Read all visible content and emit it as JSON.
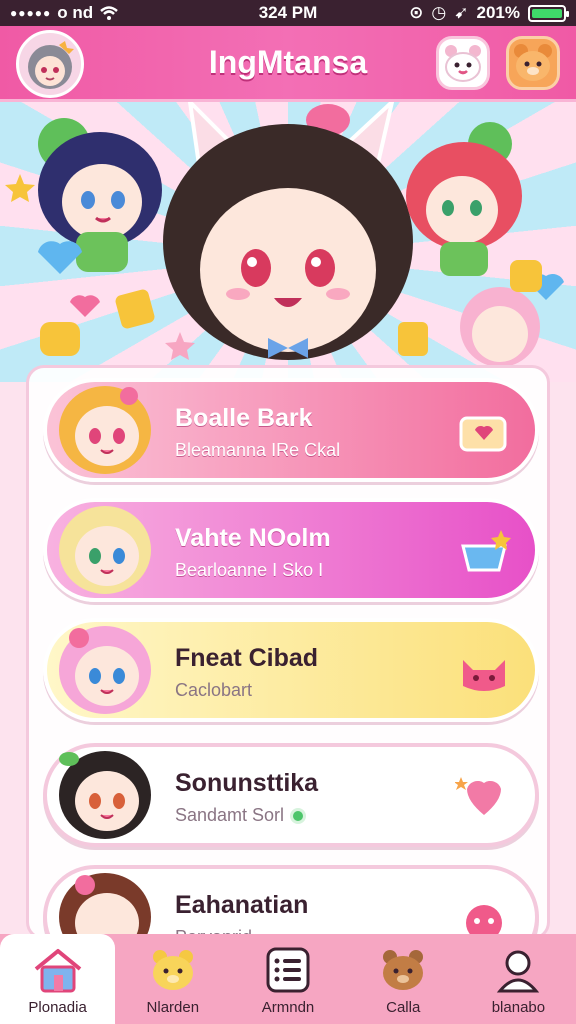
{
  "status_bar": {
    "carrier": "o nd",
    "time": "324 PM",
    "battery": "201%"
  },
  "header": {
    "title": "IngMtansa"
  },
  "cards": [
    {
      "title": "Boalle Bark",
      "subtitle": "Bleamanna IRe Ckal",
      "icon": "heart-box-icon"
    },
    {
      "title": "Vahte NOolm",
      "subtitle": "Bearloanne I Sko I",
      "icon": "basket-icon"
    },
    {
      "title": "Fneat Cibad",
      "subtitle": "Caclobart",
      "icon": "cat-face-icon"
    },
    {
      "title": "Sonunsttika",
      "subtitle": "Sandamt Sorl",
      "icon": "heart-icon"
    },
    {
      "title": "Eahanatian",
      "subtitle": "Porvanrid",
      "icon": "monster-icon"
    }
  ],
  "bottom_nav": [
    {
      "label": "Plonadia",
      "icon": "house-icon",
      "active": true
    },
    {
      "label": "Nlarden",
      "icon": "bear-face-icon",
      "active": false
    },
    {
      "label": "Armndn",
      "icon": "list-icon",
      "active": false
    },
    {
      "label": "Calla",
      "icon": "brown-bear-icon",
      "active": false
    },
    {
      "label": "blanabo",
      "icon": "profile-icon",
      "active": false
    }
  ],
  "colors": {
    "header": "#f05aa5",
    "card1": "#f26d9e",
    "card2": "#e750c8",
    "card3": "#fbe07a",
    "nav": "#f6a6c2"
  }
}
